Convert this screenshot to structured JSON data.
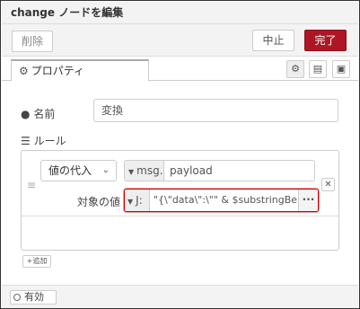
{
  "window": {
    "title": "change ノードを編集"
  },
  "toolbar": {
    "delete_label": "削除",
    "cancel_label": "中止",
    "done_label": "完了"
  },
  "tabs": {
    "properties_label": "プロパティ",
    "icons": [
      "gear-icon",
      "description-icon",
      "appearance-icon"
    ]
  },
  "form": {
    "name_label": "名前",
    "name_value": "変換",
    "rules_label": "ルール",
    "rule": {
      "action": "値の代入",
      "target_type": "msg.",
      "target_value": "payload",
      "value_label": "対象の値",
      "value_type": "J:",
      "value_expr": "\"{\\\"data\\\":\\\"\" & $substringBefore(r"
    },
    "add_label": "追加"
  },
  "footer": {
    "enabled_label": "有効"
  },
  "colors": {
    "done_button": "#ad1625",
    "error_border": "#cc0000"
  }
}
